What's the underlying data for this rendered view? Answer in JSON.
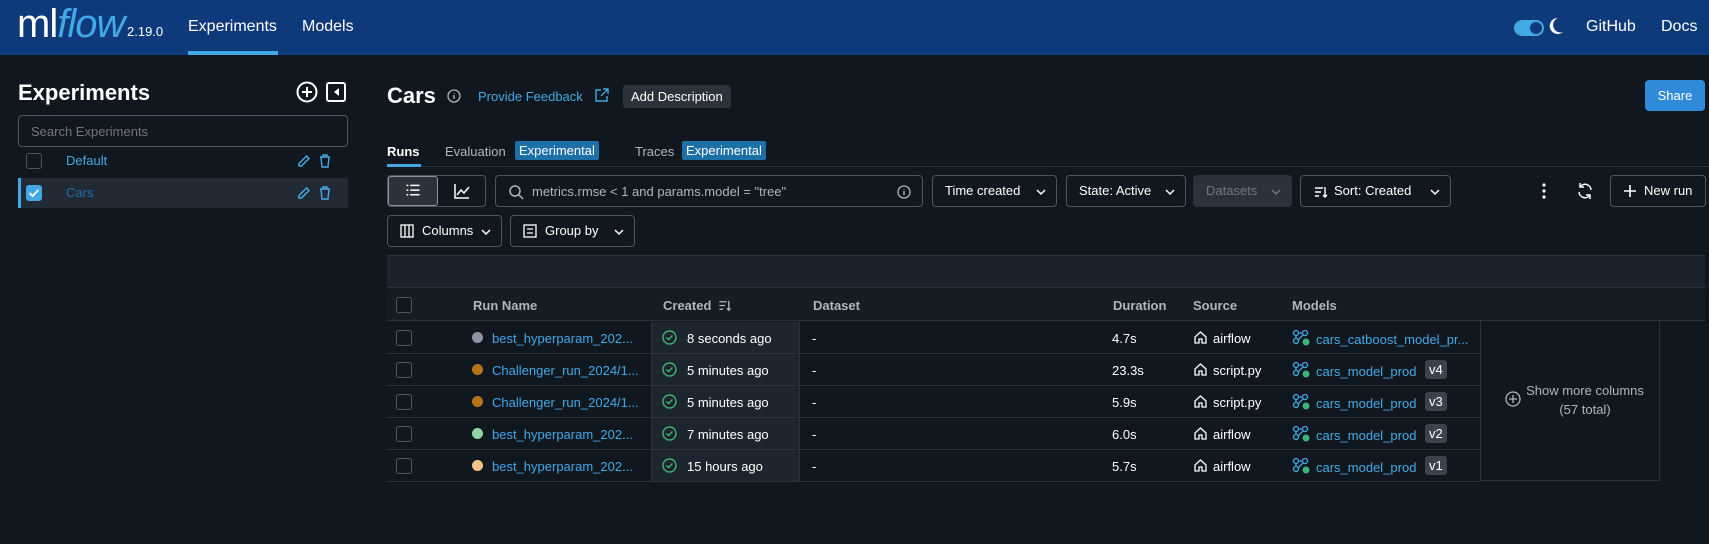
{
  "topbar": {
    "logo_ml": "ml",
    "logo_flow": "flow",
    "version": "2.19.0",
    "nav": [
      "Experiments",
      "Models"
    ],
    "github": "GitHub",
    "docs": "Docs"
  },
  "sidebar": {
    "title": "Experiments",
    "search_placeholder": "Search Experiments",
    "experiments": [
      {
        "name": "Default",
        "checked": false
      },
      {
        "name": "Cars",
        "checked": true
      }
    ]
  },
  "header": {
    "title": "Cars",
    "feedback": "Provide Feedback",
    "add_description": "Add Description",
    "share": "Share"
  },
  "tabs": {
    "runs": "Runs",
    "evaluation": "Evaluation",
    "traces": "Traces",
    "badge": "Experimental"
  },
  "toolbar": {
    "search": "metrics.rmse < 1 and params.model = \"tree\"",
    "time_created": "Time created",
    "state": "State: Active",
    "datasets": "Datasets",
    "sort": "Sort: Created",
    "new_run": "New run",
    "columns": "Columns",
    "group_by": "Group by"
  },
  "table": {
    "headers": {
      "run_name": "Run Name",
      "created": "Created",
      "dataset": "Dataset",
      "duration": "Duration",
      "source": "Source",
      "models": "Models"
    },
    "rows": [
      {
        "color": "#8a96a3",
        "name": "best_hyperparam_202...",
        "created": "8 seconds ago",
        "dataset": "-",
        "duration": "4.7s",
        "source": "airflow",
        "model": "cars_catboost_model_pr...",
        "version": ""
      },
      {
        "color": "#b8741a",
        "name": "Challenger_run_2024/1...",
        "created": "5 minutes ago",
        "dataset": "-",
        "duration": "23.3s",
        "source": "script.py",
        "model": "cars_model_prod",
        "version": "v4"
      },
      {
        "color": "#b8741a",
        "name": "Challenger_run_2024/1...",
        "created": "5 minutes ago",
        "dataset": "-",
        "duration": "5.9s",
        "source": "script.py",
        "model": "cars_model_prod",
        "version": "v3"
      },
      {
        "color": "#8fd6a0",
        "name": "best_hyperparam_202...",
        "created": "7 minutes ago",
        "dataset": "-",
        "duration": "6.0s",
        "source": "airflow",
        "model": "cars_model_prod",
        "version": "v2"
      },
      {
        "color": "#f4c28a",
        "name": "best_hyperparam_202...",
        "created": "15 hours ago",
        "dataset": "-",
        "duration": "5.7s",
        "source": "airflow",
        "model": "cars_model_prod",
        "version": "v1"
      }
    ],
    "show_more": "Show more columns (57 total)"
  },
  "colors": {
    "topbar": "#0e3a7b",
    "accent": "#43a9e6",
    "background": "#11171f",
    "primary_button": "#2f8ad9"
  }
}
